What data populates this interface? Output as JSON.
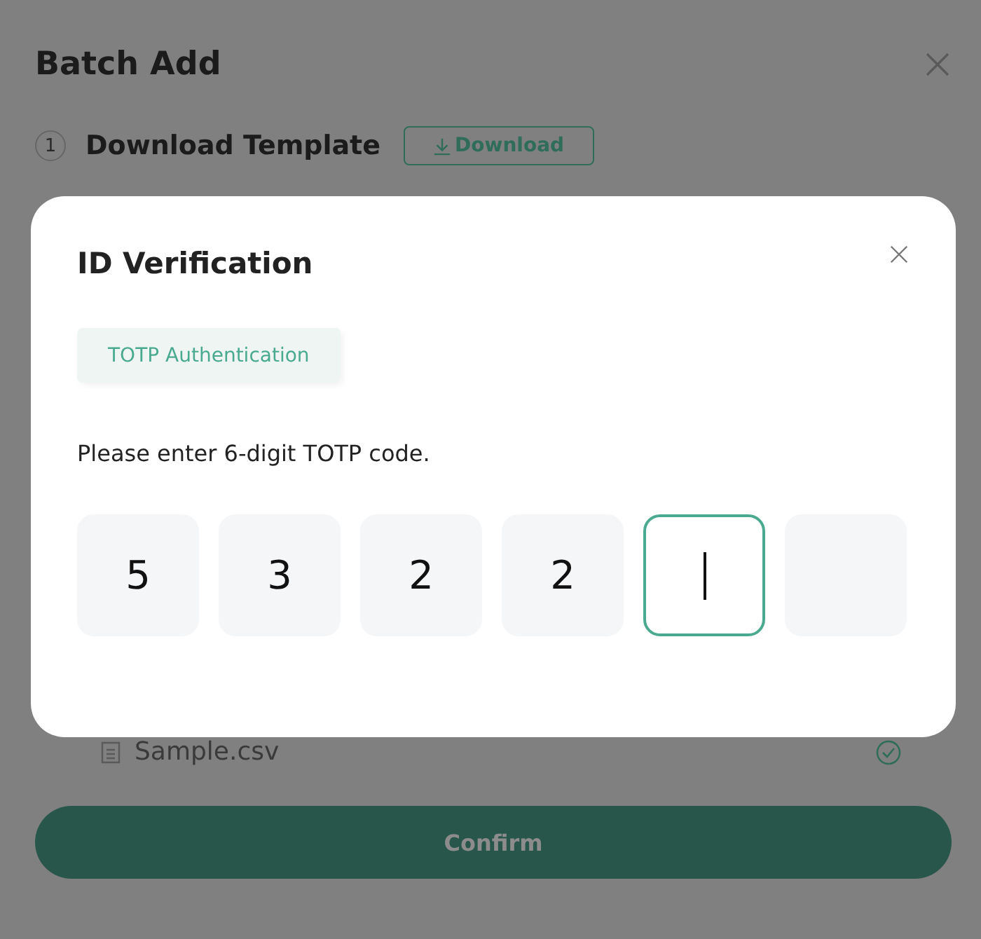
{
  "dialog": {
    "title": "Batch Add",
    "steps": [
      {
        "number": "1",
        "title": "Download Template",
        "button": "Download"
      }
    ],
    "file": {
      "name": "Sample.csv"
    },
    "confirm": "Confirm"
  },
  "verification": {
    "title": "ID Verification",
    "tabs": [
      {
        "label": "TOTP Authentication",
        "selected": true
      }
    ],
    "prompt": "Please enter 6-digit TOTP code.",
    "digits": [
      {
        "value": "5",
        "focused": false
      },
      {
        "value": "3",
        "focused": false
      },
      {
        "value": "2",
        "focused": false
      },
      {
        "value": "2",
        "focused": false
      },
      {
        "focused": true
      },
      {
        "focused": false
      }
    ]
  }
}
